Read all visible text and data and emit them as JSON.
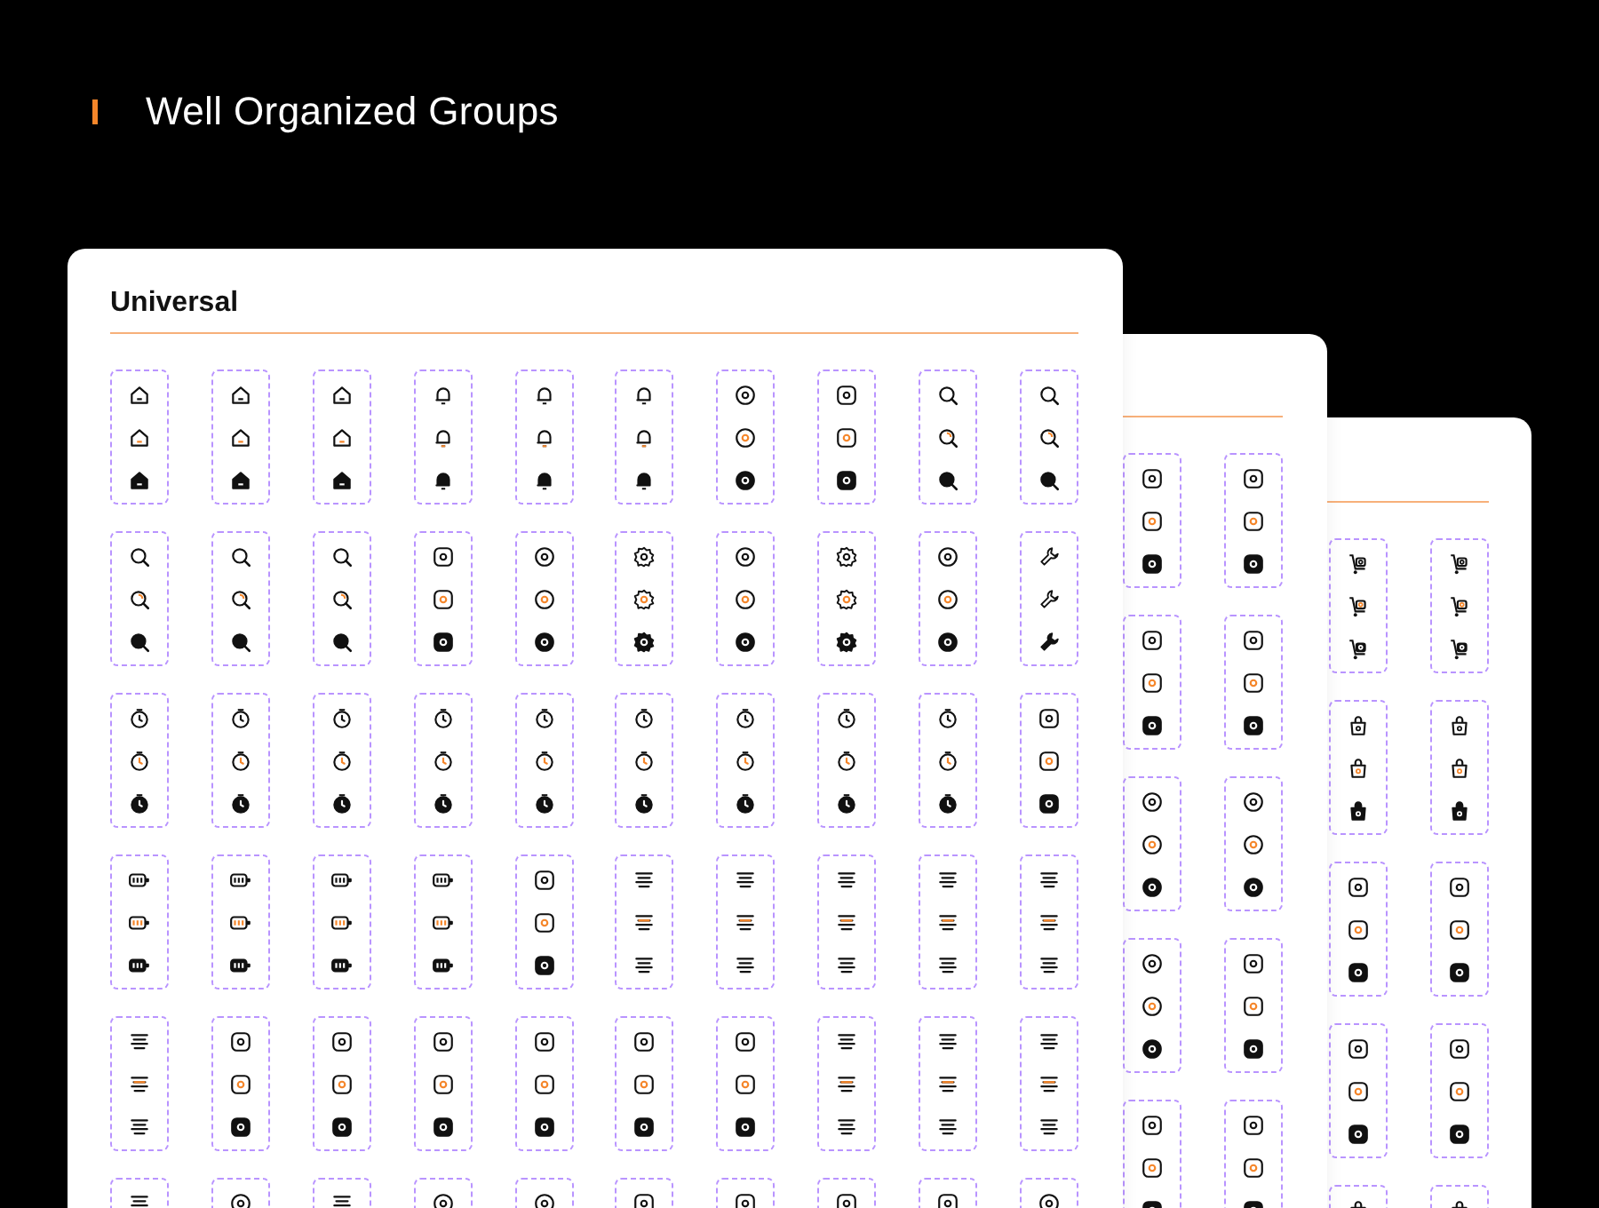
{
  "header": {
    "title": "Well Organized Groups"
  },
  "sheets": [
    {
      "title": "Universal"
    }
  ]
}
